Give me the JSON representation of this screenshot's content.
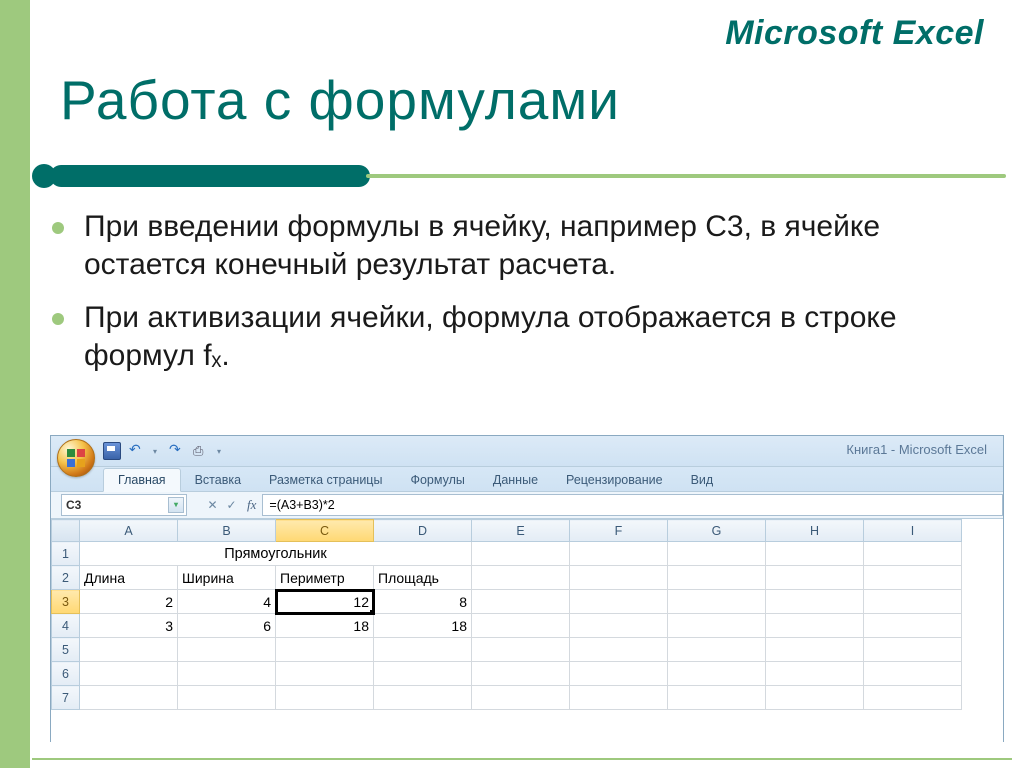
{
  "brand": "Microsoft Excel",
  "title": "Работа с формулами",
  "bullets": [
    "При введении формулы в ячейку, например С3, в ячейке остается конечный результат расчета.",
    "При активизации ячейки, формула отображается в строке формул fₓ."
  ],
  "excel": {
    "window_title": "Книга1 - Microsoft Excel",
    "tabs": [
      "Главная",
      "Вставка",
      "Разметка страницы",
      "Формулы",
      "Данные",
      "Рецензирование",
      "Вид"
    ],
    "active_tab_index": 0,
    "name_box": "C3",
    "formula": "=(A3+B3)*2",
    "columns": [
      "A",
      "B",
      "C",
      "D",
      "E",
      "F",
      "G",
      "H",
      "I"
    ],
    "selected_col_index": 2,
    "selected_row_index": 2,
    "merged_header": "Прямоугольник",
    "row2": [
      "Длина",
      "Ширина",
      "Периметр",
      "Площадь"
    ],
    "row3": [
      "2",
      "4",
      "12",
      "8"
    ],
    "row4": [
      "3",
      "6",
      "18",
      "18"
    ],
    "qat_icons": [
      "save-icon",
      "undo-icon",
      "redo-icon",
      "print-icon",
      "dropdown-icon"
    ]
  }
}
